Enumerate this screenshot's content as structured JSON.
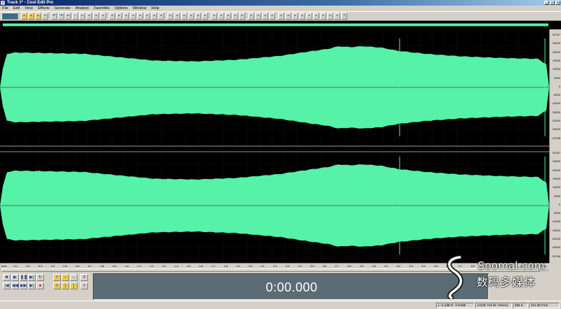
{
  "window": {
    "title": "Track 1* - Cool Edit Pro",
    "icon": "cool-edit-app-icon"
  },
  "menu": [
    "File",
    "Edit",
    "View",
    "Effects",
    "Generate",
    "Analyze",
    "Favorites",
    "Options",
    "Window",
    "Help"
  ],
  "display": {
    "time": "0:00.000"
  },
  "timeline": {
    "labels": [
      "hms",
      "0:1",
      "0:2",
      "0:3",
      "0:4",
      "0:5",
      "0:6",
      "0:7",
      "0:8",
      "0:9",
      "1:0",
      "1:1",
      "1:2",
      "1:3",
      "1:4",
      "1:5",
      "1:6",
      "1:7",
      "1:8",
      "1:9",
      "2:0",
      "2:1",
      "2:2",
      "2:3",
      "2:4",
      "2:5",
      "2:6",
      "2:7",
      "2:8",
      "2:9",
      "3:0",
      "3:1",
      "3:2",
      "3:3",
      "3:4",
      "3:5",
      "3:6",
      "3:7",
      "3:8",
      "3:9",
      "4:0",
      "4:1",
      "4:2",
      "4:3",
      "hms"
    ]
  },
  "amplitude_ruler": {
    "labels": [
      "32767",
      "25000",
      "20000",
      "15000",
      "10000",
      "5000",
      "0",
      "-5000",
      "-10000",
      "-15000",
      "-20000",
      "-25000",
      "-32768",
      "32767",
      "25000",
      "20000",
      "15000",
      "10000",
      "5000",
      "0",
      "-5000",
      "-10000",
      "-15000",
      "-20000",
      "-25000",
      "-32768"
    ]
  },
  "watermark": {
    "en": "Soomal.com",
    "cn": "数码多媒体"
  },
  "status": {
    "cells": [
      "L: 8.1dB  R: -0.04dB",
      "44100 ?16-bit ?Stereo",
      "886 K",
      "212.58 Free"
    ]
  },
  "colors": {
    "waveform": "#55f2a8",
    "background": "#000000",
    "centerline": "#3f7a60",
    "display": "#5c6c74"
  }
}
